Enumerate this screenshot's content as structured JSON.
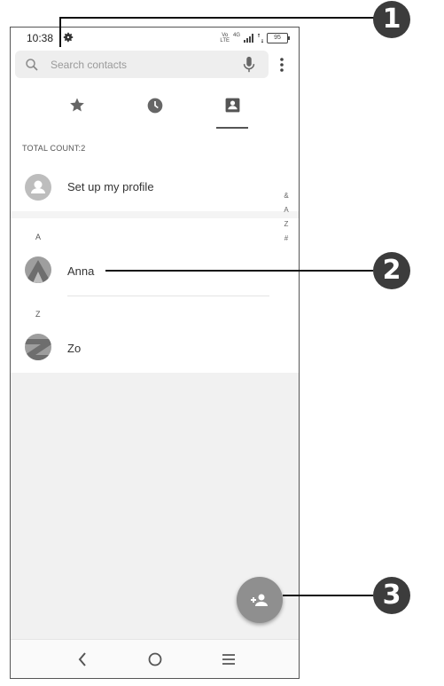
{
  "status": {
    "time": "10:38",
    "volte_top": "Vo",
    "volte_bottom": "LTE",
    "network": "4G",
    "battery": "95"
  },
  "search": {
    "placeholder": "Search contacts"
  },
  "tabs": [
    {
      "name": "favorites",
      "icon": "star-icon"
    },
    {
      "name": "recents",
      "icon": "clock-icon"
    },
    {
      "name": "contacts",
      "icon": "contact-card-icon",
      "selected": true
    }
  ],
  "contacts": {
    "total_label": "TOTAL COUNT:2",
    "profile_label": "Set up my profile",
    "sections": [
      {
        "letter": "A",
        "name": "Anna"
      },
      {
        "letter": "Z",
        "name": "Zo"
      }
    ],
    "index": [
      "&",
      "A",
      "Z",
      "#"
    ]
  },
  "fab": {
    "icon": "add-person-icon"
  },
  "nav": {
    "icons": [
      "back-icon",
      "home-icon",
      "recents-menu-icon"
    ]
  },
  "callouts": [
    "1",
    "2",
    "3"
  ],
  "colors": {
    "fab": "#8f8f8f",
    "callout": "#3c3c3c",
    "search_bg": "#eeeeee"
  }
}
